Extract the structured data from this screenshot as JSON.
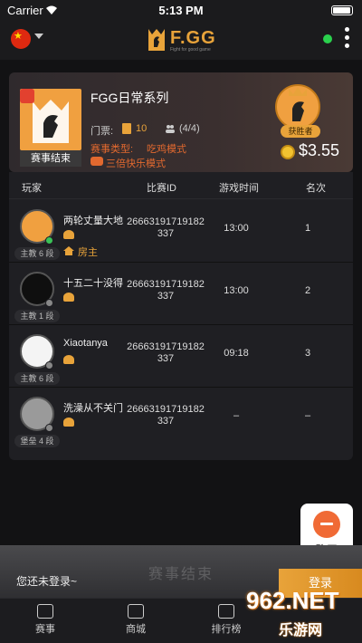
{
  "status_bar": {
    "carrier": "Carrier",
    "time": "5:13 PM"
  },
  "header": {
    "logo_text": "F.GG",
    "logo_tagline": "Fight for good game"
  },
  "match": {
    "title": "FGG日常系列",
    "status_badge": "赛事结束",
    "ticket_label": "门票:",
    "ticket_value": "10",
    "players_value": "(4/4)",
    "type_label": "赛事类型:",
    "type_value": "吃鸡模式",
    "mode_value": "三倍快乐模式",
    "winner_label": "获胜者",
    "prize": "$3.55"
  },
  "table": {
    "columns": [
      "玩家",
      "比赛ID",
      "游戏时间",
      "名次"
    ],
    "rows": [
      {
        "name": "两轮丈量大地",
        "level": "主教 6 段",
        "host_label": "房主",
        "match_id_line1": "26663191719182",
        "match_id_line2": "337",
        "time": "13:00",
        "rank": "1",
        "online": true
      },
      {
        "name": "十五二十没得",
        "level": "主教 1 段",
        "host_label": "",
        "match_id_line1": "26663191719182",
        "match_id_line2": "337",
        "time": "13:00",
        "rank": "2",
        "online": false
      },
      {
        "name": "Xiaotanya",
        "level": "主教 6 段",
        "host_label": "",
        "match_id_line1": "26663191719182",
        "match_id_line2": "337",
        "time": "09:18",
        "rank": "3",
        "online": false
      },
      {
        "name": "洗澡从不关门",
        "level": "堡垒 4 段",
        "host_label": "",
        "match_id_line1": "26663191719182",
        "match_id_line2": "337",
        "time": "–",
        "rank": "–",
        "online": false
      }
    ]
  },
  "chat": {
    "label": "聊天"
  },
  "login_bar": {
    "ended_watermark": "赛事结束",
    "not_logged": "您还未登录~",
    "login_button": "登录"
  },
  "tabs": [
    {
      "label": "赛事",
      "icon": "trophy-icon"
    },
    {
      "label": "商城",
      "icon": "video-icon"
    },
    {
      "label": "排行榜",
      "icon": "ranking-icon"
    }
  ],
  "watermark": {
    "text": "962.NET",
    "sub": "乐游网"
  },
  "colors": {
    "accent": "#e8a33a",
    "alert": "#e2692f",
    "online": "#2ad14d"
  }
}
